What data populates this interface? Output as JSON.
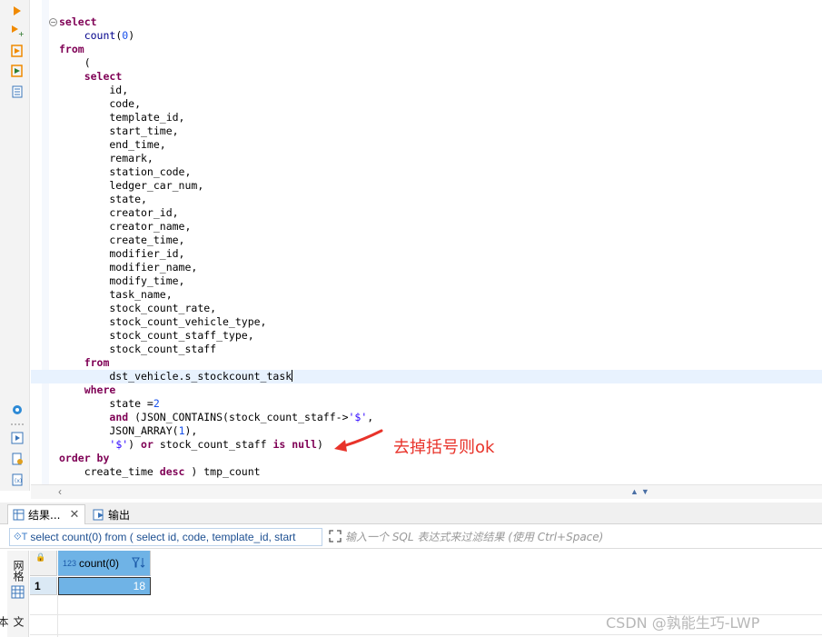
{
  "editor": {
    "lines": [
      [
        {
          "t": "select",
          "c": "kw"
        }
      ],
      [
        {
          "t": "    "
        },
        {
          "t": "count",
          "c": "fn"
        },
        {
          "t": "("
        },
        {
          "t": "0",
          "c": "num"
        },
        {
          "t": ")"
        }
      ],
      [
        {
          "t": "from",
          "c": "kw"
        }
      ],
      [
        {
          "t": "    ("
        }
      ],
      [
        {
          "t": "    "
        },
        {
          "t": "select",
          "c": "kw"
        }
      ],
      [
        {
          "t": "        id,"
        }
      ],
      [
        {
          "t": "        code,"
        }
      ],
      [
        {
          "t": "        template_id,"
        }
      ],
      [
        {
          "t": "        start_time,"
        }
      ],
      [
        {
          "t": "        end_time,"
        }
      ],
      [
        {
          "t": "        remark,"
        }
      ],
      [
        {
          "t": "        station_code,"
        }
      ],
      [
        {
          "t": "        ledger_car_num,"
        }
      ],
      [
        {
          "t": "        state,"
        }
      ],
      [
        {
          "t": "        creator_id,"
        }
      ],
      [
        {
          "t": "        creator_name,"
        }
      ],
      [
        {
          "t": "        create_time,"
        }
      ],
      [
        {
          "t": "        modifier_id,"
        }
      ],
      [
        {
          "t": "        modifier_name,"
        }
      ],
      [
        {
          "t": "        modify_time,"
        }
      ],
      [
        {
          "t": "        task_name,"
        }
      ],
      [
        {
          "t": "        stock_count_rate,"
        }
      ],
      [
        {
          "t": "        stock_count_vehicle_type,"
        }
      ],
      [
        {
          "t": "        stock_count_staff_type,"
        }
      ],
      [
        {
          "t": "        stock_count_staff"
        }
      ],
      [
        {
          "t": "    "
        },
        {
          "t": "from",
          "c": "kw"
        }
      ],
      [
        {
          "t": "        dst_vehicle.s_stockcount_task"
        }
      ],
      [
        {
          "t": "    "
        },
        {
          "t": "where",
          "c": "kw"
        }
      ],
      [
        {
          "t": "        state ="
        },
        {
          "t": "2",
          "c": "num"
        }
      ],
      [
        {
          "t": "        "
        },
        {
          "t": "and",
          "c": "kw"
        },
        {
          "t": " (JSON_CONTAINS(stock_count_staff->"
        },
        {
          "t": "'$'",
          "c": "str"
        },
        {
          "t": ","
        }
      ],
      [
        {
          "t": "        JSON_ARRAY("
        },
        {
          "t": "1",
          "c": "num"
        },
        {
          "t": "),"
        }
      ],
      [
        {
          "t": "        "
        },
        {
          "t": "'$'",
          "c": "str"
        },
        {
          "t": ") "
        },
        {
          "t": "or",
          "c": "kw"
        },
        {
          "t": " stock_count_staff "
        },
        {
          "t": "is",
          "c": "kw"
        },
        {
          "t": " "
        },
        {
          "t": "null",
          "c": "kw"
        },
        {
          "t": ")"
        }
      ],
      [
        {
          "t": "order by",
          "c": "kw"
        }
      ],
      [
        {
          "t": "    create_time "
        },
        {
          "t": "desc",
          "c": "kw"
        },
        {
          "t": " ) tmp_count"
        }
      ]
    ],
    "active_line_index": 26
  },
  "annotation": {
    "text": "去掉括号则ok",
    "color": "#e8332a"
  },
  "tabs": {
    "results_label": "结果...",
    "output_label": "输出"
  },
  "filter": {
    "sql_preview": "select count(0) from ( select id, code, template_id, start",
    "sql_tag": "⟐T",
    "placeholder": "输入一个 SQL 表达式来过滤结果 (使用 Ctrl+Space)"
  },
  "side_tabs": {
    "grid_label": "网格",
    "text_label": "文本"
  },
  "grid": {
    "columns": [
      {
        "type_badge": "123",
        "name": "count(0)"
      }
    ],
    "rows": [
      {
        "row_number": "1",
        "values": [
          "18"
        ]
      }
    ]
  },
  "watermark": "CSDN @孰能生巧-LWP",
  "colors": {
    "accent": "#6fb3e6",
    "keyword": "#7f0055",
    "string": "#2a00ff"
  }
}
